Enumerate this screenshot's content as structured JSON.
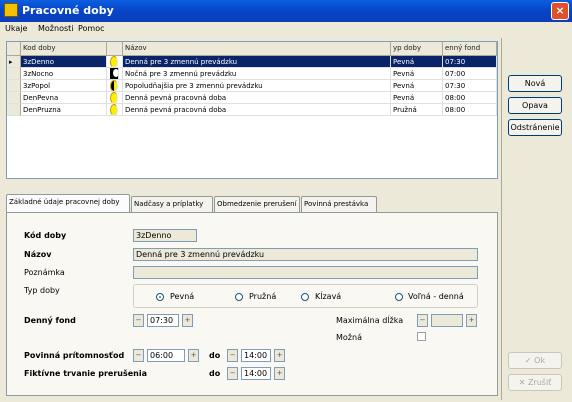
{
  "window": {
    "title": "Pracovné doby",
    "close_glyph": "×"
  },
  "menu": [
    "Ukaje",
    "Možnosti",
    "Pomoc"
  ],
  "grid": {
    "columns": [
      "Kod doby",
      "Názov",
      "yp doby",
      "enný fond"
    ],
    "selected_index": 0,
    "rows": [
      {
        "kod": "3zDenno",
        "icon": "sun-icon",
        "nazov": "Denná pre 3 zmennú prevádzku",
        "typ": "Pevná",
        "fond": "07:30"
      },
      {
        "kod": "3zNocno",
        "icon": "moon-icon",
        "nazov": "Nočná pre 3 zmennú prevádzku",
        "typ": "Pevná",
        "fond": "07:00"
      },
      {
        "kod": "3zPopol",
        "icon": "sunmoon-icon",
        "nazov": "Popoludňajšia pre 3 zmennú prevádzku",
        "typ": "Pevná",
        "fond": "07:30"
      },
      {
        "kod": "DenPevna",
        "icon": "sun-icon",
        "nazov": "Denná pevná pracovná doba",
        "typ": "Pevná",
        "fond": "08:00"
      },
      {
        "kod": "DenPruzna",
        "icon": "sun-icon",
        "nazov": "Denná pevná pracovná doba",
        "typ": "Pružná",
        "fond": "08:00"
      }
    ]
  },
  "side_buttons": {
    "nova": "Nová",
    "opava": "Opava",
    "odstranenie": "Odstránenie",
    "ok": "Ok",
    "zrusit": "Zrušiť"
  },
  "tabs": [
    "Základné údaje pracovnej doby",
    "Nadčasy a príplatky",
    "Obmedzenie prerušení",
    "Povinná prestávka"
  ],
  "form": {
    "kod_label": "Kód doby",
    "kod_value": "3zDenno",
    "nazov_label": "Názov",
    "nazov_value": "Denná pre 3 zmennú prevádzku",
    "poznamka_label": "Poznámka",
    "poznamka_value": "",
    "typ_label": "Typ doby",
    "typ_options": [
      "Pevná",
      "Pružná",
      "Kĺzavá",
      "Voľná - denná"
    ],
    "typ_selected": 0,
    "fond_label": "Denný fond",
    "fond_value": "07:30",
    "max_dlzka_label": "Maximálna dĺžka",
    "max_dlzka_value": "",
    "mozna_label": "Možná",
    "povinna_label": "Povinná prítomnosť",
    "od_label": "od",
    "povinna_od": "06:00",
    "do_label": "do",
    "povinna_do": "14:00",
    "fiktivne_label": "Fiktívne trvanie prerušenia",
    "fiktivne_do_label": "do",
    "fiktivne_do": "14:00"
  }
}
